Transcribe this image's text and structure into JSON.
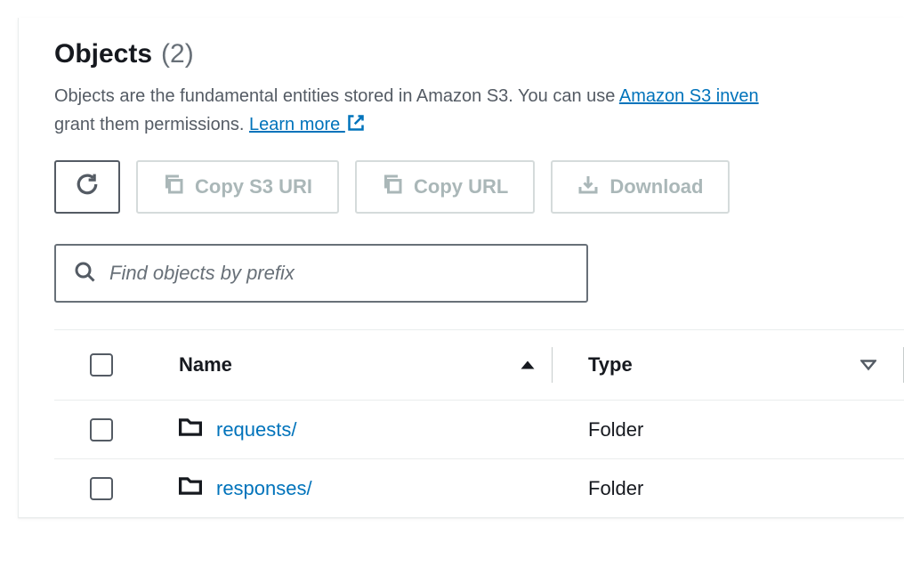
{
  "header": {
    "title": "Objects",
    "count_display": "(2)"
  },
  "description": {
    "text_prefix": "Objects are the fundamental entities stored in Amazon S3. You can use ",
    "inventory_link": "Amazon S3 inven",
    "text_suffix": "grant them permissions. ",
    "learn_more": "Learn more "
  },
  "toolbar": {
    "copy_s3_uri": "Copy S3 URI",
    "copy_url": "Copy URL",
    "download": "Download"
  },
  "search": {
    "placeholder": "Find objects by prefix"
  },
  "table": {
    "columns": {
      "name": "Name",
      "type": "Type"
    },
    "rows": [
      {
        "name": "requests/",
        "type": "Folder"
      },
      {
        "name": "responses/",
        "type": "Folder"
      }
    ]
  }
}
